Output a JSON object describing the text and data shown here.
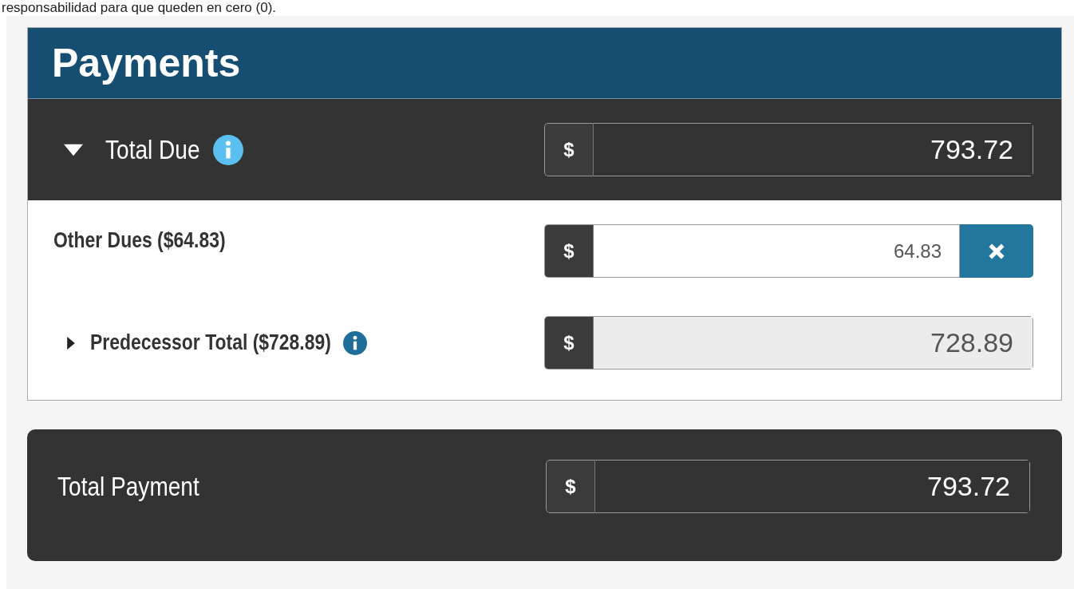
{
  "intro_text": "responsabilidad para que queden en cero (0).",
  "panel": {
    "title": "Payments",
    "total_due": {
      "label": "Total Due",
      "expanded": true,
      "info": true,
      "currency": "$",
      "value": "793.72"
    },
    "items": [
      {
        "kind": "editable",
        "label": "Other Dues ($64.83)",
        "currency": "$",
        "value": "64.83"
      },
      {
        "kind": "readonly",
        "label": "Predecessor Total ($728.89)",
        "expanded": false,
        "info": true,
        "currency": "$",
        "value": "728.89"
      }
    ]
  },
  "total_payment": {
    "label": "Total Payment",
    "currency": "$",
    "value": "793.72"
  }
}
